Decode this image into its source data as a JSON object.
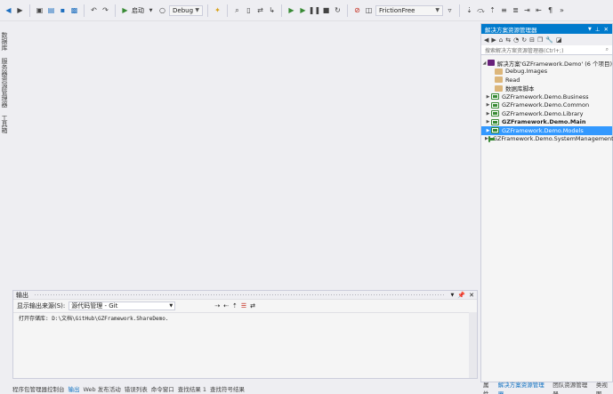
{
  "toolbar": {
    "start_label": "启动",
    "config_label": "Debug",
    "target_label": "FrictionFree"
  },
  "left_tabs": [
    "数据库",
    "服务器资源管理器",
    "工具箱"
  ],
  "output": {
    "title": "输出",
    "source_label": "显示输出来源(S):",
    "source_value": "源代码管理 - Git",
    "content": "打开存储库:   D:\\文档\\GitHub\\GZFramework.ShareDemo."
  },
  "bottom_tabs": [
    "程序包管理器控制台",
    "输出",
    "Web 发布活动",
    "错误列表",
    "命令窗口",
    "查找结果 1",
    "查找符号结果"
  ],
  "bottom_active": "输出",
  "solution_explorer": {
    "title": "解决方案资源管理器",
    "search_placeholder": "搜索解决方案资源管理器(Ctrl+;)",
    "solution_label": "解决方案'GZFramework.Demo' (6 个项目)",
    "items": [
      {
        "label": "Debug.Images",
        "type": "folder"
      },
      {
        "label": "Read",
        "type": "folder"
      },
      {
        "label": "数据库脚本",
        "type": "folder"
      },
      {
        "label": "GZFramework.Demo.Business",
        "type": "project"
      },
      {
        "label": "GZFramework.Demo.Common",
        "type": "project"
      },
      {
        "label": "GZFramework.Demo.Library",
        "type": "project"
      },
      {
        "label": "GZFramework.Demo.Main",
        "type": "project-bold"
      },
      {
        "label": "GZFramework.Demo.Models",
        "type": "project-selected"
      },
      {
        "label": "GZFramework.Demo.SystemManagement",
        "type": "project"
      }
    ]
  },
  "bottom_right_tabs": [
    "属性",
    "解决方案资源管理器",
    "团队资源管理器",
    "类视图"
  ],
  "bottom_right_active": "解决方案资源管理器"
}
